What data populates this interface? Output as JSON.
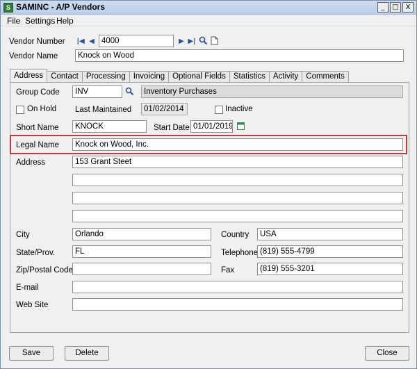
{
  "window": {
    "title": "SAMINC - A/P Vendors",
    "icon": "sage-app-icon",
    "controls": {
      "minimize": "_",
      "restore": "□",
      "close": "X"
    }
  },
  "menu": {
    "file": "File",
    "settings": "Settings",
    "help": "Help"
  },
  "header": {
    "vendor_number_label": "Vendor Number",
    "vendor_number": "4000",
    "vendor_name_label": "Vendor Name",
    "vendor_name": "Knock on Wood"
  },
  "tabs": [
    {
      "label": "Address",
      "active": true
    },
    {
      "label": "Contact"
    },
    {
      "label": "Processing"
    },
    {
      "label": "Invoicing"
    },
    {
      "label": "Optional Fields"
    },
    {
      "label": "Statistics"
    },
    {
      "label": "Activity"
    },
    {
      "label": "Comments"
    }
  ],
  "address": {
    "group_code_label": "Group Code",
    "group_code": "INV",
    "group_desc": "Inventory Purchases",
    "on_hold_label": "On Hold",
    "last_maintained_label": "Last Maintained",
    "last_maintained": "01/02/2014",
    "inactive_label": "Inactive",
    "short_name_label": "Short Name",
    "short_name": "KNOCK",
    "start_date_label": "Start Date",
    "start_date": "01/01/2019",
    "legal_name_label": "Legal Name",
    "legal_name": "Knock on Wood, Inc.",
    "address_label": "Address",
    "address_lines": [
      "153 Grant Steet",
      "",
      "",
      ""
    ],
    "city_label": "City",
    "city": "Orlando",
    "country_label": "Country",
    "country": "USA",
    "state_label": "State/Prov.",
    "state": "FL",
    "telephone_label": "Telephone",
    "telephone": "(819) 555-4799",
    "zip_label": "Zip/Postal Code",
    "zip": "",
    "fax_label": "Fax",
    "fax": "(819) 555-3201",
    "email_label": "E-mail",
    "email": "",
    "website_label": "Web Site",
    "website": ""
  },
  "buttons": {
    "save": "Save",
    "delete": "Delete",
    "close": "Close"
  },
  "colors": {
    "highlight": "#c0393b",
    "titlebar": "#cddcf0",
    "icon_blue": "#1f4fa8"
  }
}
